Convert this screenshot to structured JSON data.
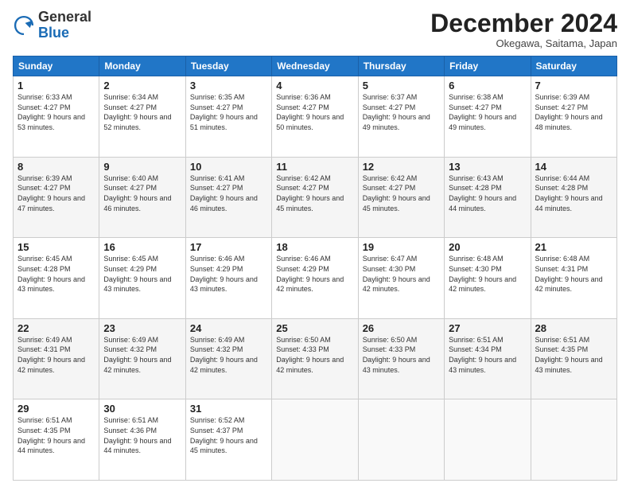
{
  "logo": {
    "line1": "General",
    "line2": "Blue"
  },
  "header": {
    "month": "December 2024",
    "location": "Okegawa, Saitama, Japan"
  },
  "weekdays": [
    "Sunday",
    "Monday",
    "Tuesday",
    "Wednesday",
    "Thursday",
    "Friday",
    "Saturday"
  ],
  "weeks": [
    [
      {
        "day": "1",
        "sunrise": "6:33 AM",
        "sunset": "4:27 PM",
        "daylight": "9 hours and 53 minutes."
      },
      {
        "day": "2",
        "sunrise": "6:34 AM",
        "sunset": "4:27 PM",
        "daylight": "9 hours and 52 minutes."
      },
      {
        "day": "3",
        "sunrise": "6:35 AM",
        "sunset": "4:27 PM",
        "daylight": "9 hours and 51 minutes."
      },
      {
        "day": "4",
        "sunrise": "6:36 AM",
        "sunset": "4:27 PM",
        "daylight": "9 hours and 50 minutes."
      },
      {
        "day": "5",
        "sunrise": "6:37 AM",
        "sunset": "4:27 PM",
        "daylight": "9 hours and 49 minutes."
      },
      {
        "day": "6",
        "sunrise": "6:38 AM",
        "sunset": "4:27 PM",
        "daylight": "9 hours and 49 minutes."
      },
      {
        "day": "7",
        "sunrise": "6:39 AM",
        "sunset": "4:27 PM",
        "daylight": "9 hours and 48 minutes."
      }
    ],
    [
      {
        "day": "8",
        "sunrise": "6:39 AM",
        "sunset": "4:27 PM",
        "daylight": "9 hours and 47 minutes."
      },
      {
        "day": "9",
        "sunrise": "6:40 AM",
        "sunset": "4:27 PM",
        "daylight": "9 hours and 46 minutes."
      },
      {
        "day": "10",
        "sunrise": "6:41 AM",
        "sunset": "4:27 PM",
        "daylight": "9 hours and 46 minutes."
      },
      {
        "day": "11",
        "sunrise": "6:42 AM",
        "sunset": "4:27 PM",
        "daylight": "9 hours and 45 minutes."
      },
      {
        "day": "12",
        "sunrise": "6:42 AM",
        "sunset": "4:27 PM",
        "daylight": "9 hours and 45 minutes."
      },
      {
        "day": "13",
        "sunrise": "6:43 AM",
        "sunset": "4:28 PM",
        "daylight": "9 hours and 44 minutes."
      },
      {
        "day": "14",
        "sunrise": "6:44 AM",
        "sunset": "4:28 PM",
        "daylight": "9 hours and 44 minutes."
      }
    ],
    [
      {
        "day": "15",
        "sunrise": "6:45 AM",
        "sunset": "4:28 PM",
        "daylight": "9 hours and 43 minutes."
      },
      {
        "day": "16",
        "sunrise": "6:45 AM",
        "sunset": "4:29 PM",
        "daylight": "9 hours and 43 minutes."
      },
      {
        "day": "17",
        "sunrise": "6:46 AM",
        "sunset": "4:29 PM",
        "daylight": "9 hours and 43 minutes."
      },
      {
        "day": "18",
        "sunrise": "6:46 AM",
        "sunset": "4:29 PM",
        "daylight": "9 hours and 42 minutes."
      },
      {
        "day": "19",
        "sunrise": "6:47 AM",
        "sunset": "4:30 PM",
        "daylight": "9 hours and 42 minutes."
      },
      {
        "day": "20",
        "sunrise": "6:48 AM",
        "sunset": "4:30 PM",
        "daylight": "9 hours and 42 minutes."
      },
      {
        "day": "21",
        "sunrise": "6:48 AM",
        "sunset": "4:31 PM",
        "daylight": "9 hours and 42 minutes."
      }
    ],
    [
      {
        "day": "22",
        "sunrise": "6:49 AM",
        "sunset": "4:31 PM",
        "daylight": "9 hours and 42 minutes."
      },
      {
        "day": "23",
        "sunrise": "6:49 AM",
        "sunset": "4:32 PM",
        "daylight": "9 hours and 42 minutes."
      },
      {
        "day": "24",
        "sunrise": "6:49 AM",
        "sunset": "4:32 PM",
        "daylight": "9 hours and 42 minutes."
      },
      {
        "day": "25",
        "sunrise": "6:50 AM",
        "sunset": "4:33 PM",
        "daylight": "9 hours and 42 minutes."
      },
      {
        "day": "26",
        "sunrise": "6:50 AM",
        "sunset": "4:33 PM",
        "daylight": "9 hours and 43 minutes."
      },
      {
        "day": "27",
        "sunrise": "6:51 AM",
        "sunset": "4:34 PM",
        "daylight": "9 hours and 43 minutes."
      },
      {
        "day": "28",
        "sunrise": "6:51 AM",
        "sunset": "4:35 PM",
        "daylight": "9 hours and 43 minutes."
      }
    ],
    [
      {
        "day": "29",
        "sunrise": "6:51 AM",
        "sunset": "4:35 PM",
        "daylight": "9 hours and 44 minutes."
      },
      {
        "day": "30",
        "sunrise": "6:51 AM",
        "sunset": "4:36 PM",
        "daylight": "9 hours and 44 minutes."
      },
      {
        "day": "31",
        "sunrise": "6:52 AM",
        "sunset": "4:37 PM",
        "daylight": "9 hours and 45 minutes."
      },
      null,
      null,
      null,
      null
    ]
  ]
}
